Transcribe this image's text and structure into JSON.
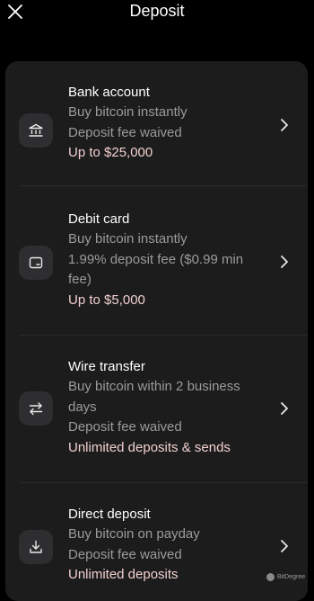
{
  "header": {
    "title": "Deposit",
    "close_icon": "close-icon"
  },
  "options": [
    {
      "title": "Bank account",
      "lines": [
        "Buy bitcoin instantly",
        "Deposit fee waived"
      ],
      "limit": "Up to $25,000",
      "icon": "bank-icon"
    },
    {
      "title": "Debit card",
      "lines": [
        "Buy bitcoin instantly",
        "1.99% deposit fee ($0.99 min",
        "fee)"
      ],
      "limit": "Up to $5,000",
      "icon": "card-icon"
    },
    {
      "title": "Wire transfer",
      "lines": [
        "Buy bitcoin within 2 business",
        "days",
        "Deposit fee waived"
      ],
      "limit": "Unlimited deposits & sends",
      "icon": "transfer-arrows-icon"
    },
    {
      "title": "Direct deposit",
      "lines": [
        "Buy bitcoin on payday",
        "Deposit fee waived"
      ],
      "limit": "Unlimited deposits",
      "icon": "download-tray-icon"
    }
  ],
  "watermark": {
    "text": "BitDegree"
  },
  "colors": {
    "background": "#000000",
    "sheet": "#1c1c1d",
    "icon_tile": "#2e2e30",
    "title_text": "#ffffff",
    "secondary_text": "#9b9b9b",
    "limit_text": "#f2d0cf"
  }
}
